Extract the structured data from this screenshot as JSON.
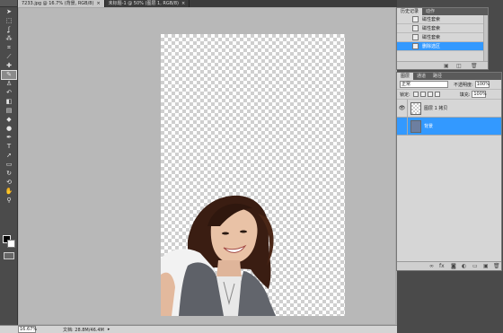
{
  "document": {
    "tabs": [
      {
        "label": "7233.jpg @ 16.7% (背景, RGB/8)",
        "close": "×"
      },
      {
        "label": "未标题-1 @ 50% (图层 1, RGB/8)",
        "close": "×"
      }
    ]
  },
  "toolbar": {
    "tools": [
      {
        "icon": "move-tool-icon",
        "glyph": "➤"
      },
      {
        "icon": "marquee-tool-icon",
        "glyph": "⬚"
      },
      {
        "icon": "lasso-tool-icon",
        "glyph": "ʆ"
      },
      {
        "icon": "magic-wand-tool-icon",
        "glyph": "⁂"
      },
      {
        "icon": "crop-tool-icon",
        "glyph": "⌗"
      },
      {
        "icon": "eyedropper-tool-icon",
        "glyph": "⟋"
      },
      {
        "icon": "healing-brush-tool-icon",
        "glyph": "✚"
      },
      {
        "icon": "brush-tool-icon",
        "glyph": "✎"
      },
      {
        "icon": "clone-stamp-tool-icon",
        "glyph": "♙"
      },
      {
        "icon": "history-brush-tool-icon",
        "glyph": "↶"
      },
      {
        "icon": "eraser-tool-icon",
        "glyph": "◧"
      },
      {
        "icon": "gradient-tool-icon",
        "glyph": "▤"
      },
      {
        "icon": "blur-tool-icon",
        "glyph": "◆"
      },
      {
        "icon": "dodge-tool-icon",
        "glyph": "●"
      },
      {
        "icon": "pen-tool-icon",
        "glyph": "✒"
      },
      {
        "icon": "type-tool-icon",
        "glyph": "T"
      },
      {
        "icon": "path-selection-tool-icon",
        "glyph": "➚"
      },
      {
        "icon": "shape-tool-icon",
        "glyph": "▭"
      },
      {
        "icon": "3d-rotate-tool-icon",
        "glyph": "↻"
      },
      {
        "icon": "3d-orbit-tool-icon",
        "glyph": "⟲"
      },
      {
        "icon": "hand-tool-icon",
        "glyph": "✋"
      },
      {
        "icon": "zoom-tool-icon",
        "glyph": "⚲"
      }
    ]
  },
  "status": {
    "zoom": "16.67%",
    "file_info": "文档: 28.8M/46.4M",
    "arrow": "▸"
  },
  "history_panel": {
    "tabs": [
      "历史记录",
      "动作"
    ],
    "items": [
      {
        "label": "磁性套索"
      },
      {
        "label": "磁性套索"
      },
      {
        "label": "磁性套索"
      },
      {
        "label": "删除选区"
      }
    ],
    "footer_icons": [
      "▣",
      "◫",
      "🗑"
    ]
  },
  "layers_panel": {
    "tabs": [
      "图层",
      "通道",
      "路径"
    ],
    "blend_mode": "正常",
    "opacity_label": "不透明度:",
    "opacity_value": "100%",
    "lock_label": "锁定:",
    "fill_label": "填充:",
    "fill_value": "100%",
    "layers": [
      {
        "name": "图层 1 拷贝",
        "visible_glyph": "👁",
        "selected": false
      },
      {
        "name": "背景",
        "visible_glyph": "",
        "selected": true
      }
    ],
    "footer_icons": [
      "∞",
      "fx",
      "◙",
      "◐",
      "▭",
      "▣",
      "🗑"
    ]
  },
  "colors": {
    "selection_blue": "#3399ff",
    "toolbar_bg": "#4b4b4b",
    "canvas_area": "#b8b8b8"
  }
}
